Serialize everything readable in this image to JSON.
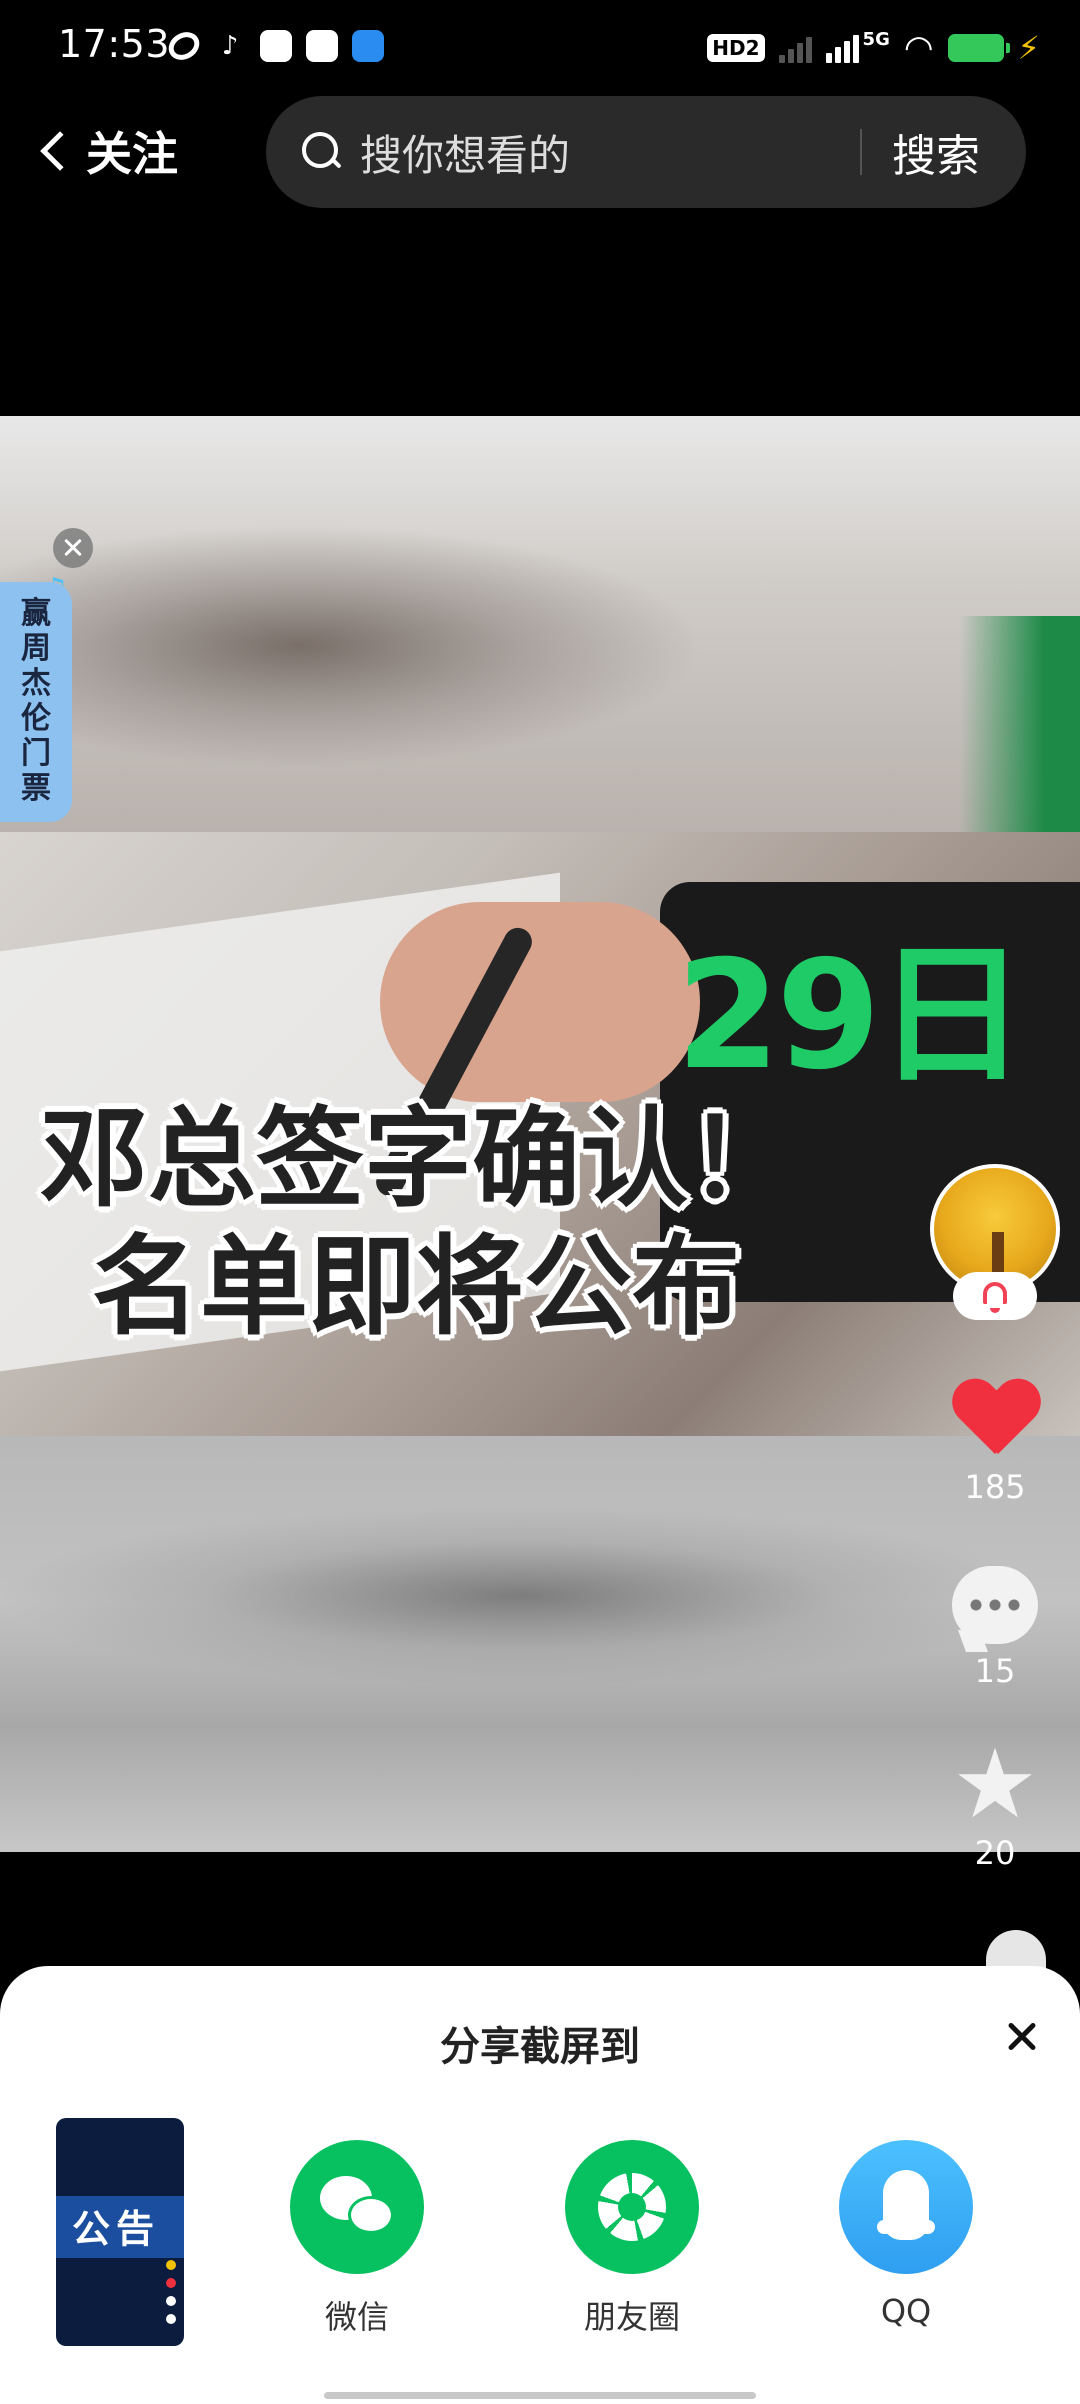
{
  "status_bar": {
    "time": "17:53",
    "hd_badge": "HD2",
    "network": "5G"
  },
  "nav": {
    "back_label": "关注",
    "search_placeholder": "搜你想看的",
    "search_button": "搜索"
  },
  "video": {
    "day_label": "29日",
    "headline_line1": "邓总签字确认！",
    "headline_line2": "名单即将公布"
  },
  "promo": {
    "text": "赢周杰伦门票"
  },
  "actions": {
    "likes": "185",
    "comments": "15",
    "favorites": "20"
  },
  "share_sheet": {
    "title": "分享截屏到",
    "thumbnail_text": "公告",
    "targets": [
      {
        "label": "微信",
        "icon": "wechat-icon",
        "color": "#07c160"
      },
      {
        "label": "朋友圈",
        "icon": "moments-icon",
        "color": "#07c160"
      },
      {
        "label": "QQ",
        "icon": "qq-icon",
        "color": "#3fa9f5"
      }
    ]
  },
  "colors": {
    "like_red": "#f0303f",
    "day_green": "#1fcb66",
    "promo_blue": "#8dc1ef"
  }
}
